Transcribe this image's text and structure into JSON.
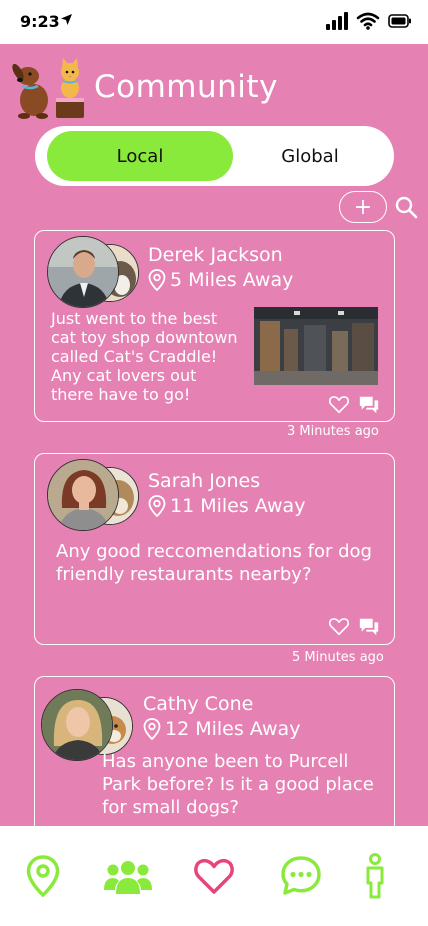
{
  "status_bar": {
    "time": "9:23"
  },
  "header": {
    "title": "Community"
  },
  "toggle": {
    "local_label": "Local",
    "global_label": "Global",
    "active": "Local"
  },
  "actions": {
    "add_label": "+"
  },
  "colors": {
    "background": "#e682b3",
    "accent_green": "#8aea3b",
    "accent_pink": "#e8447c",
    "white": "#ffffff"
  },
  "posts": [
    {
      "author": "Derek Jackson",
      "distance": "5 Miles Away",
      "text": "Just went to the best cat toy shop downtown called Cat's Craddle! Any cat lovers out there have to go!",
      "timestamp": "3 Minutes ago"
    },
    {
      "author": "Sarah Jones",
      "distance": "11 Miles Away",
      "text": "Any good reccomendations for dog friendly restaurants nearby?",
      "timestamp": "5 Minutes ago"
    },
    {
      "author": "Cathy Cone",
      "distance": "12 Miles Away",
      "text": "Has anyone been to Purcell Park before? Is it a good place for small dogs?"
    }
  ],
  "nav": {
    "items": [
      {
        "icon": "map-pin-icon"
      },
      {
        "icon": "group-icon"
      },
      {
        "icon": "heart-icon"
      },
      {
        "icon": "chat-icon"
      },
      {
        "icon": "person-icon"
      }
    ]
  }
}
